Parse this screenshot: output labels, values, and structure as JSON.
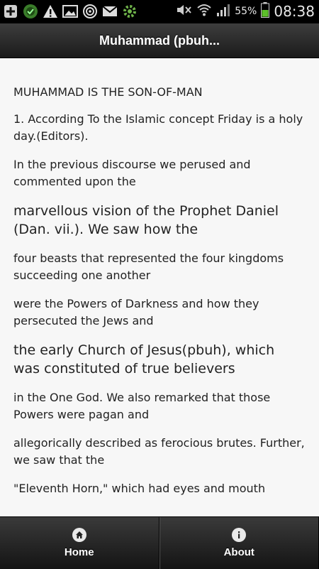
{
  "status_bar": {
    "left_icons": [
      "plus-icon",
      "shield-icon",
      "warning-icon",
      "image-icon",
      "target-icon",
      "mail-icon",
      "gear-icon"
    ],
    "battery_percent": "55%",
    "time": "08:38"
  },
  "header": {
    "title": "Muhammad (pbuh..."
  },
  "article": {
    "paragraphs": [
      "MUHAMMAD IS THE SON-OF-MAN",
      "1. According To the Islamic concept Friday is a holy day.(Editors).",
      "In the previous discourse we perused and commented upon the",
      "marvellous vision of the Prophet Daniel (Dan. vii.). We saw how the",
      "four beasts that represented the four kingdoms succeeding one another",
      "were the Powers of Darkness and how they persecuted the Jews and",
      "the early Church of Jesus(pbuh), which was constituted of true believers",
      "in the One God. We also remarked that those Powers were pagan and",
      "allegorically described as ferocious brutes. Further, we saw that the",
      "\"Eleventh Horn,\" which had eyes and mouth"
    ]
  },
  "tabbar": {
    "tabs": [
      {
        "label": "Home",
        "icon": "home-icon"
      },
      {
        "label": "About",
        "icon": "info-icon"
      }
    ]
  }
}
